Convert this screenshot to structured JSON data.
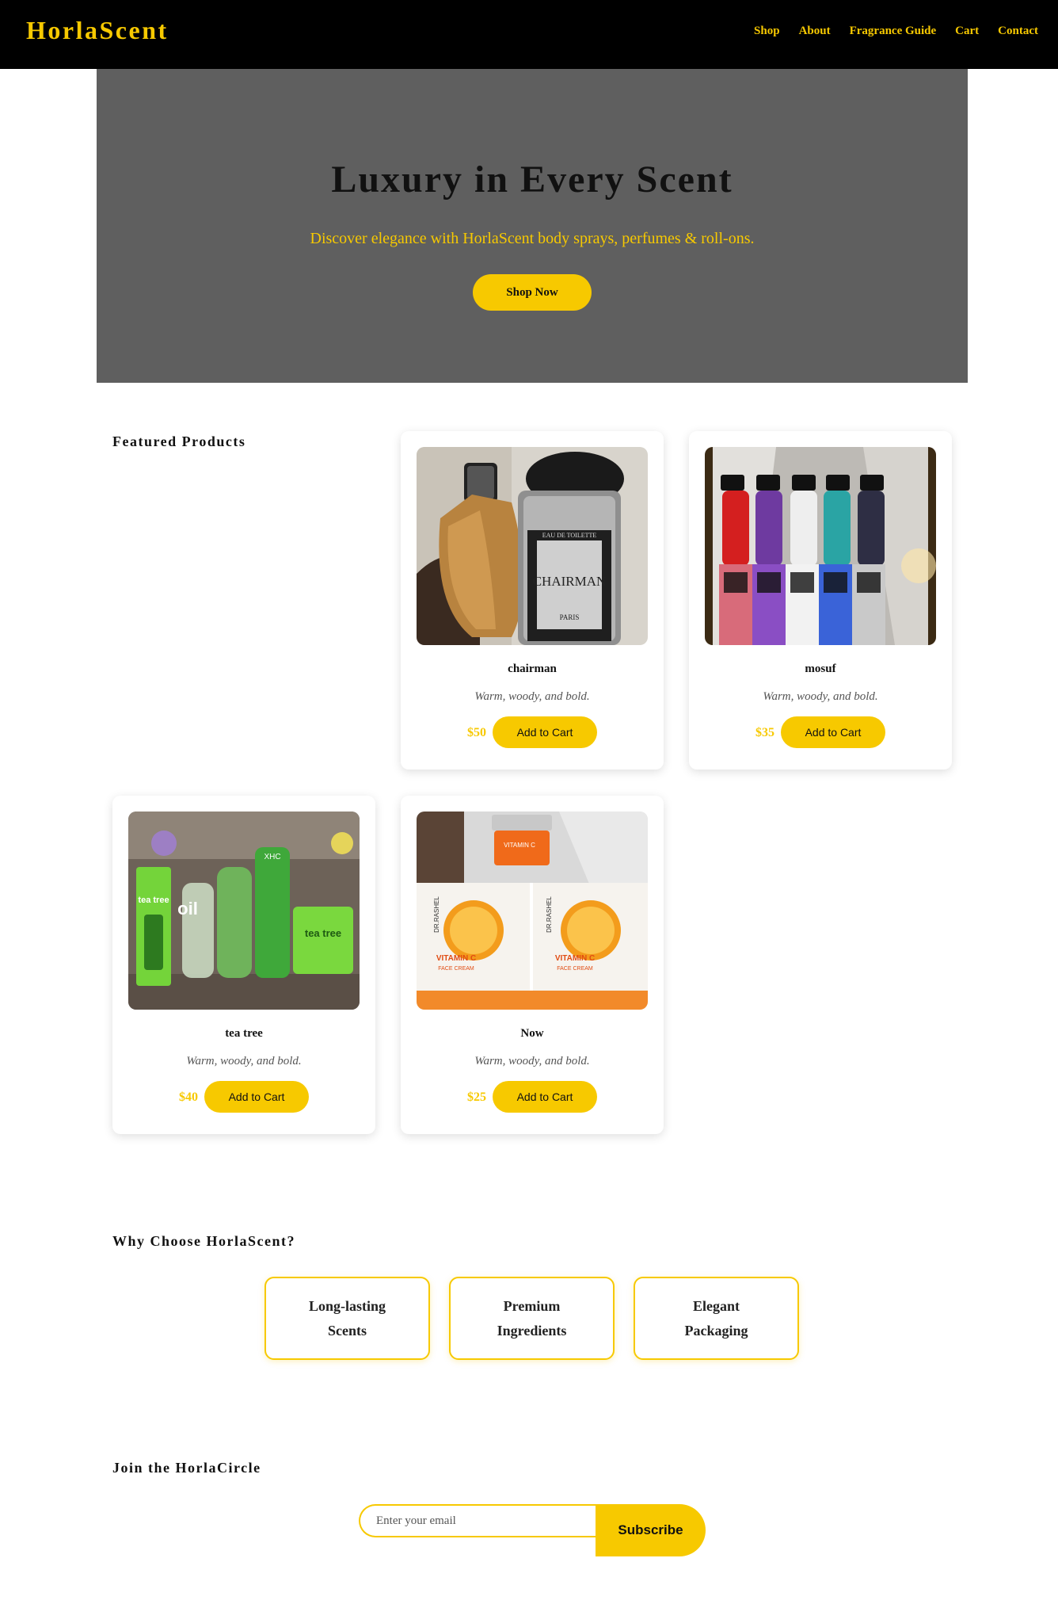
{
  "header": {
    "logo": "HorlaScent",
    "nav": [
      "Shop",
      "About",
      "Fragrance Guide",
      "Cart",
      "Contact"
    ]
  },
  "hero": {
    "title": "Luxury in Every Scent",
    "subtitle": "Discover elegance with HorlaScent body sprays, perfumes & roll-ons.",
    "button": "Shop Now"
  },
  "featured": {
    "title": "Featured Products",
    "products": [
      {
        "name": "chairman",
        "description": "Warm, woody, and bold.",
        "price": "$50",
        "button": "Add to Cart",
        "image_icon": "chairman-perfume-photo"
      },
      {
        "name": "mosuf",
        "description": "Warm, woody, and bold.",
        "price": "$35",
        "button": "Add to Cart",
        "image_icon": "mosuf-perfume-set-photo"
      },
      {
        "name": "tea tree",
        "description": "Warm, woody, and bold.",
        "price": "$40",
        "button": "Add to Cart",
        "image_icon": "tea-tree-products-photo"
      },
      {
        "name": "Now",
        "description": "Warm, woody, and bold.",
        "price": "$25",
        "button": "Add to Cart",
        "image_icon": "vitamin-c-cream-photo"
      }
    ],
    "image_text": {
      "chairman": "CHAIRMAN",
      "chairman_sub": "PARIS",
      "chairman_top": "EAU DE TOILETTE",
      "teatree": "tea tree",
      "teatree_oil": "oil",
      "teatree_brand": "XHC",
      "vitc_brand": "DR.RASHEL",
      "vitc_label": "VITAMIN C",
      "vitc_sub": "FACE CREAM"
    }
  },
  "why": {
    "title": "Why Choose HorlaScent?",
    "features": [
      {
        "line1": "Long-lasting",
        "line2": "Scents"
      },
      {
        "line1": "Premium",
        "line2": "Ingredients"
      },
      {
        "line1": "Elegant",
        "line2": "Packaging"
      }
    ]
  },
  "newsletter": {
    "title": "Join the HorlaCircle",
    "placeholder": "Enter your email",
    "button": "Subscribe"
  },
  "colors": {
    "accent": "#f7c900",
    "header_bg": "#000000",
    "hero_bg": "#5f5f5f"
  }
}
